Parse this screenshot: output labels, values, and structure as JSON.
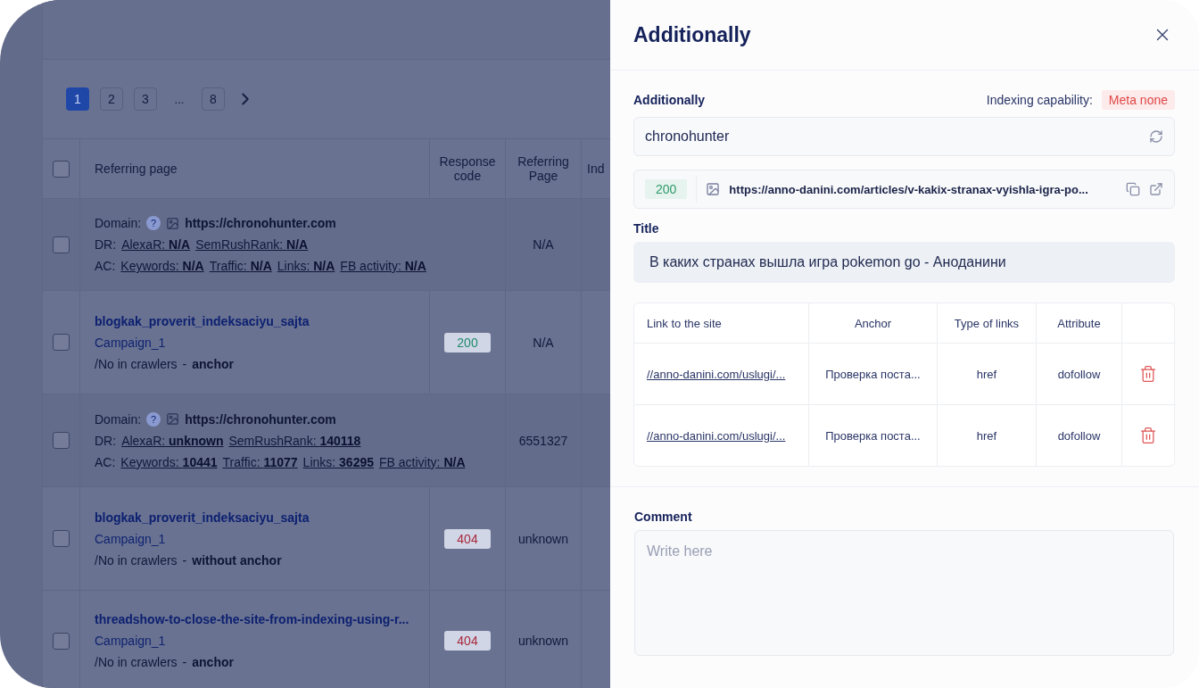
{
  "background": {
    "pagination": {
      "pages": [
        {
          "label": "1",
          "selected": true
        },
        {
          "label": "2",
          "selected": false
        },
        {
          "label": "3",
          "selected": false
        },
        {
          "label": "...",
          "selected": false
        },
        {
          "label": "8",
          "selected": false
        }
      ]
    },
    "table": {
      "select_all_checked": false,
      "columns": [
        "Referring page",
        "Response code",
        "Referring Page",
        "Ind"
      ],
      "rows": [
        {
          "kind": "domain",
          "checked": false,
          "domain_label": "Domain:",
          "help": "?",
          "url": "https://chronohunter.com",
          "dr_label": "DR:",
          "dr_metrics": [
            "AlexaR: **N/A**",
            "SemRushRank: **N/A**"
          ],
          "ac_label": "AC:",
          "ac_metrics": [
            "Keywords: **N/A**",
            "Traffic: **N/A**",
            "Links: **N/A**",
            "FB activity: **N/A**"
          ],
          "referring_page": "N/A"
        },
        {
          "kind": "page",
          "checked": false,
          "title": "blogkak_proverit_indeksaciyu_sajta",
          "campaign": "Campaign_1",
          "crawler": "/No in crawlers",
          "separator": "-",
          "anchor": "anchor",
          "response_code": "200",
          "color": "#1f8a6a",
          "referring_page": "N/A"
        },
        {
          "kind": "domain",
          "checked": false,
          "domain_label": "Domain:",
          "help": "?",
          "url": "https://chronohunter.com",
          "dr_label": "DR:",
          "dr_metrics": [
            "AlexaR: **unknown**",
            "SemRushRank: **140118**"
          ],
          "ac_label": "AC:",
          "ac_metrics": [
            "Keywords: **10441**",
            "Traffic: **11077**",
            "Links: **36295**",
            "FB activity: **N/A**"
          ],
          "referring_page": "6551327"
        },
        {
          "kind": "page",
          "title": "blogkak_proverit_indeksaciyu_sajta",
          "campaign": "Campaign_1",
          "crawler": "/No in crawlers",
          "separator": "-",
          "anchor": "without anchor",
          "response_code": "404",
          "color": "#a8283c",
          "referring_page": "unknown",
          "checked": false
        },
        {
          "kind": "page",
          "title": "threadshow-to-close-the-site-from-indexing-using-r...",
          "campaign": "Campaign_1",
          "crawler": "/No in crawlers",
          "separator": "-",
          "anchor": "anchor",
          "response_code": "404",
          "color": "#a8283c",
          "referring_page": "unknown",
          "checked": false
        }
      ]
    }
  },
  "drawer": {
    "title": "Additionally",
    "section_label": "Additionally",
    "indexing_label": "Indexing capability:",
    "indexing_badge": "Meta none",
    "name_field": {
      "value": "chronohunter"
    },
    "url_row": {
      "code": "200",
      "color": "#2d9a6a",
      "url": "https://anno-danini.com/articles/v-kakix-stranax-vyishla-igra-po..."
    },
    "title_label": "Title",
    "title_value": "В каких странах вышла игра pokemon go - Аноданини",
    "links_table": {
      "columns": [
        "Link to the site",
        "Anchor",
        "Type of links",
        "Attribute"
      ],
      "rows": [
        {
          "link": "//anno-danini.com/uslugi/...",
          "anchor": "Проверка поста...",
          "type": "href",
          "attribute": "dofollow"
        },
        {
          "link": "//anno-danini.com/uslugi/...",
          "anchor": "Проверка поста...",
          "type": "href",
          "attribute": "dofollow"
        }
      ]
    },
    "comment": {
      "label": "Comment",
      "placeholder": "Write here"
    }
  }
}
